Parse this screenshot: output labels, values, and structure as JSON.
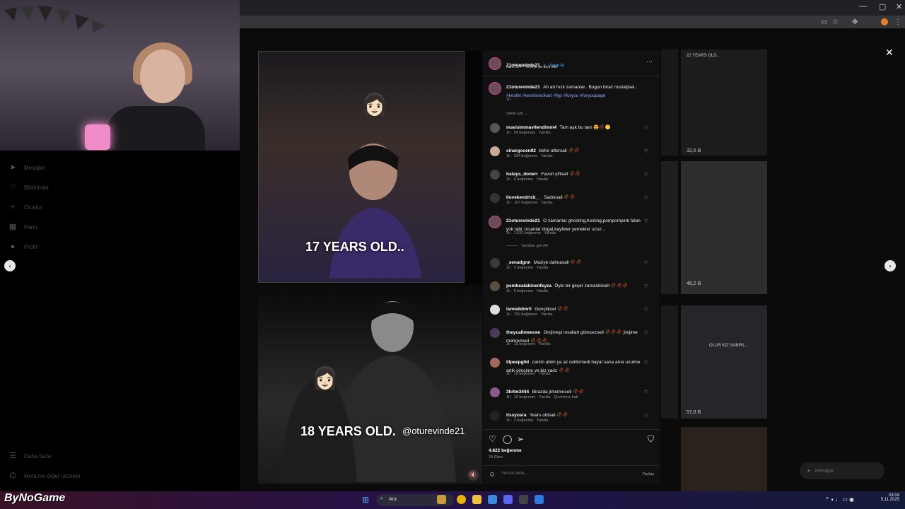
{
  "sidebar": {
    "items": [
      {
        "label": "Mesajlar",
        "icon": "send-icon"
      },
      {
        "label": "Bildirimler",
        "icon": "heart-icon"
      },
      {
        "label": "Oluştur",
        "icon": "plus-icon"
      },
      {
        "label": "Pano",
        "icon": "dashboard-icon"
      },
      {
        "label": "Profil",
        "icon": "profile-icon"
      }
    ],
    "more_label": "Daha fazla",
    "meta_label": "Meta'nın diğer ürünleri"
  },
  "backdrop": {
    "tile1_stat": "32,6 B",
    "tile2_stat": "46,2 B",
    "tile3_stat": "57,8 B",
    "tile_text_1": "22 YEARS OLD..",
    "tile_text_2": "OLUR KIZ SABIRL..."
  },
  "media": {
    "caption_top": "17 YEARS OLD..",
    "caption_bottom": "18 YEARS OLD.",
    "watermark_handle": "@oturevinde21"
  },
  "post": {
    "author": "21oturevinde21",
    "follow_label": "Takip Et",
    "audio": "rash7.24 • Ya leyli ya leyli min",
    "caption_user": "21oturevinde21",
    "caption_text": "Ah ah hızlı zamanlar.. Bugun biraz nostaljisel..",
    "caption_tags": "#keşfet #keniönecikart #fyp #foryou #foryoupage",
    "caption_time": "1h",
    "sort_label": "Senin için"
  },
  "comments": [
    {
      "user": "mavisimmavilendimm4",
      "text": "Tam aşk bu tam 😍🥀😶",
      "time": "1h",
      "likes": "54 beğenme",
      "reply": "Yanıtla"
    },
    {
      "user": "cinargocen92",
      "text": "befor aftersall 🥀🥀",
      "time": "1h",
      "likes": "334 beğenme",
      "reply": "Yanıtla"
    },
    {
      "user": "hatays_donerr",
      "text": "Favori çiftsell 🥀🥀",
      "time": "1h",
      "likes": "6 beğenme",
      "reply": "Yanıtla"
    },
    {
      "user": "llovekendrick__",
      "text": "Sadıksall 🥀🥀",
      "time": "1h",
      "likes": "107 beğenme",
      "reply": "Yanıtla"
    },
    {
      "user": "21oturevinde21",
      "text": "O zamanlar ghosting,hosting,pompompink falan yok tabi, insanlar dogal,kayfeler yemekler ucuz...",
      "time": "1h",
      "likes": "1.531 beğenme",
      "reply": "Yanıtla",
      "view_replies": "Yanıtları gör (4)"
    },
    {
      "user": "_senadgnn",
      "text": "Maziye dalmasall 🥀🥀",
      "time": "1h",
      "likes": "5 beğenme",
      "reply": "Yanıtla"
    },
    {
      "user": "pembeatabinenfeyza",
      "text": "Öyle bir geçer zamankiisell 🥀🥀🥀",
      "time": "1h",
      "likes": "5 beğenme",
      "reply": "Yanıtla"
    },
    {
      "user": "ismwildmr0",
      "text": "Gençliksel 🥀🥀",
      "time": "1h",
      "likes": "792 beğenme",
      "reply": "Yanıtla"
    },
    {
      "user": "theycallmeecee",
      "text": "Jimjimeyi insallah görecezsell 🥀🥀🥀 jimjime mahremsel 🥀🥀🥀",
      "time": "1h",
      "likes": "15 beğenme",
      "reply": "Yanıtla"
    },
    {
      "user": "lilpeepg0d",
      "text": "canim abim ya az cektirmedi hayat sana ama uzulme artik cimcime ve biz variz 🥀🥀",
      "time": "1h",
      "likes": "10 beğenme",
      "reply": "Yanıtla"
    },
    {
      "user": "3krtm3444",
      "text": "Birazda jimcimesell 🥀🥀",
      "time": "1h",
      "likes": "10 beğenme",
      "reply": "Yanıtla",
      "translate": "Çevirisine bak"
    },
    {
      "user": "itssyusra",
      "text": "Years oldsall 🥀🥀",
      "time": "1h",
      "likes": "2 beğenme",
      "reply": "Yanıtla"
    }
  ],
  "footer": {
    "likes": "4.822 beğenme",
    "date": "24 Ekim",
    "comment_placeholder": "Yorum ekle...",
    "share_label": "Paylaş"
  },
  "messages_pill": {
    "label": "Mesajlar"
  },
  "taskbar": {
    "search_label": "Ara",
    "time": "03:04",
    "date": "5.11.2025"
  },
  "streamer_watermark": "ByNoGame",
  "colors": {
    "accent": "#3897f0",
    "tag": "#8ea6ff",
    "panel": "#111111"
  }
}
